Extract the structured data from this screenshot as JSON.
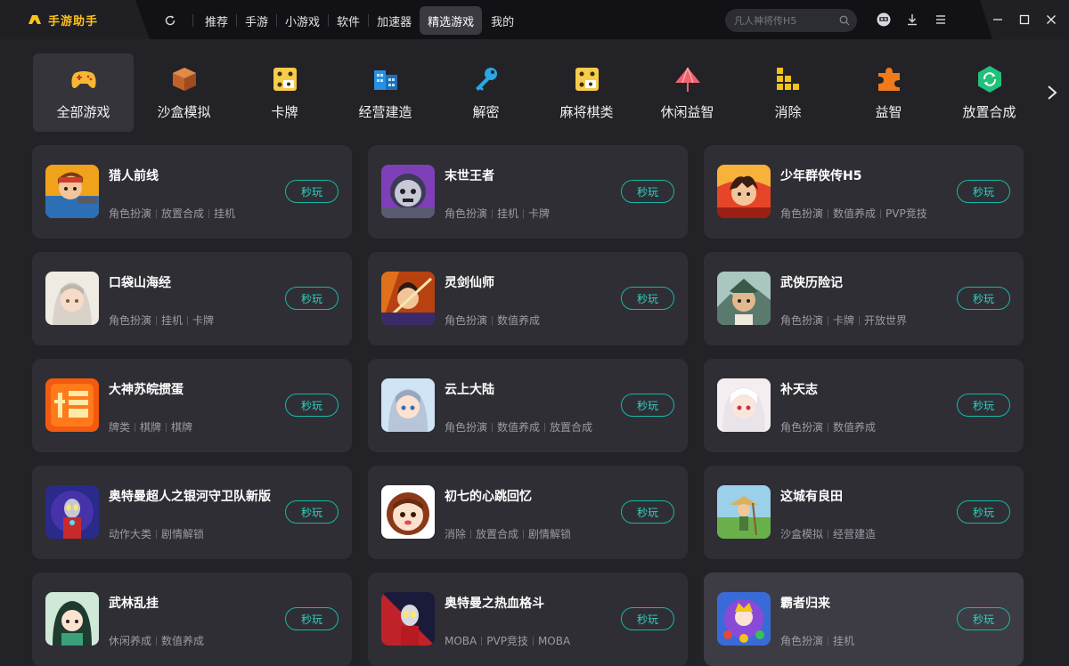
{
  "app": {
    "brand": "手游助手"
  },
  "nav": {
    "items": [
      {
        "label": "推荐",
        "active": false
      },
      {
        "label": "手游",
        "active": false
      },
      {
        "label": "小游戏",
        "active": false
      },
      {
        "label": "软件",
        "active": false
      },
      {
        "label": "加速器",
        "active": false
      },
      {
        "label": "精选游戏",
        "active": true
      },
      {
        "label": "我的",
        "active": false
      }
    ]
  },
  "search": {
    "placeholder": "凡人神将传H5"
  },
  "categories": [
    {
      "label": "全部游戏",
      "icon": "gamepad-icon",
      "active": true
    },
    {
      "label": "沙盒模拟",
      "icon": "cube-icon",
      "active": false
    },
    {
      "label": "卡牌",
      "icon": "dice-icon",
      "active": false
    },
    {
      "label": "经营建造",
      "icon": "buildings-icon",
      "active": false
    },
    {
      "label": "解密",
      "icon": "key-icon",
      "active": false
    },
    {
      "label": "麻将棋类",
      "icon": "mahjong-icon",
      "active": false
    },
    {
      "label": "休闲益智",
      "icon": "umbrella-icon",
      "active": false
    },
    {
      "label": "消除",
      "icon": "blocks-icon",
      "active": false
    },
    {
      "label": "益智",
      "icon": "puzzle-icon",
      "active": false
    },
    {
      "label": "放置合成",
      "icon": "recycle-icon",
      "active": false
    }
  ],
  "play_label": "秒玩",
  "games": [
    {
      "title": "猎人前线",
      "tags": [
        "角色扮演",
        "放置合成",
        "挂机"
      ],
      "thumb": "hunter-avatar-icon"
    },
    {
      "title": "末世王者",
      "tags": [
        "角色扮演",
        "挂机",
        "卡牌"
      ],
      "thumb": "zombie-avatar-icon"
    },
    {
      "title": "少年群侠传H5",
      "tags": [
        "角色扮演",
        "数值养成",
        "PVP竞技"
      ],
      "thumb": "hero-avatar-icon"
    },
    {
      "title": "口袋山海经",
      "tags": [
        "角色扮演",
        "挂机",
        "卡牌"
      ],
      "thumb": "fairy-avatar-icon"
    },
    {
      "title": "灵剑仙师",
      "tags": [
        "角色扮演",
        "数值养成"
      ],
      "thumb": "swordsman-avatar-icon"
    },
    {
      "title": "武侠历险记",
      "tags": [
        "角色扮演",
        "卡牌",
        "开放世界"
      ],
      "thumb": "wuxia-avatar-icon"
    },
    {
      "title": "大神苏皖掼蛋",
      "tags": [
        "牌类",
        "棋牌",
        "棋牌"
      ],
      "thumb": "guandan-logo-icon"
    },
    {
      "title": "云上大陆",
      "tags": [
        "角色扮演",
        "数值养成",
        "放置合成"
      ],
      "thumb": "anime-girl-icon"
    },
    {
      "title": "补天志",
      "tags": [
        "角色扮演",
        "数值养成"
      ],
      "thumb": "white-hair-girl-icon"
    },
    {
      "title": "奥特曼超人之银河守卫队新版",
      "tags": [
        "动作大类",
        "剧情解锁"
      ],
      "thumb": "ultraman-icon"
    },
    {
      "title": "初七的心跳回忆",
      "tags": [
        "消除",
        "放置合成",
        "剧情解锁"
      ],
      "thumb": "chibi-girl-icon"
    },
    {
      "title": "这城有良田",
      "tags": [
        "沙盒模拟",
        "经营建造"
      ],
      "thumb": "farmer-icon"
    },
    {
      "title": "武林乱挂",
      "tags": [
        "休闲养成",
        "数值养成"
      ],
      "thumb": "martial-girl-icon"
    },
    {
      "title": "奥特曼之热血格斗",
      "tags": [
        "MOBA",
        "PVP竞技",
        "MOBA"
      ],
      "thumb": "ultraman-fight-icon"
    },
    {
      "title": "霸者归来",
      "tags": [
        "角色扮演",
        "挂机"
      ],
      "thumb": "king-return-icon",
      "hover": true
    }
  ]
}
